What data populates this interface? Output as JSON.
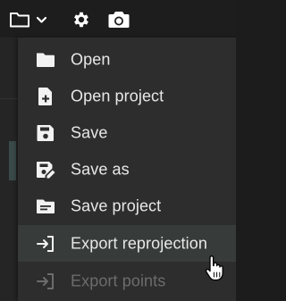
{
  "toolbar": {
    "icons": [
      "folder-icon",
      "chevron-down-icon",
      "gear-icon",
      "camera-icon"
    ]
  },
  "menu": {
    "items": [
      {
        "label": "Open",
        "icon": "folder-icon",
        "enabled": true
      },
      {
        "label": "Open project",
        "icon": "file-plus-icon",
        "enabled": true
      },
      {
        "label": "Save",
        "icon": "save-icon",
        "enabled": true
      },
      {
        "label": "Save as",
        "icon": "save-as-icon",
        "enabled": true
      },
      {
        "label": "Save project",
        "icon": "folder-text-icon",
        "enabled": true
      },
      {
        "label": "Export reprojection",
        "icon": "export-icon",
        "enabled": true,
        "hovered": true
      },
      {
        "label": "Export points",
        "icon": "export-icon",
        "enabled": false
      }
    ]
  },
  "colors": {
    "menu_bg": "#2d2d2d",
    "hover_bg": "#373b3a",
    "text": "#e8e8e8",
    "disabled_text": "#6c6c6c",
    "toolbar_bg": "#1d1d1d"
  }
}
